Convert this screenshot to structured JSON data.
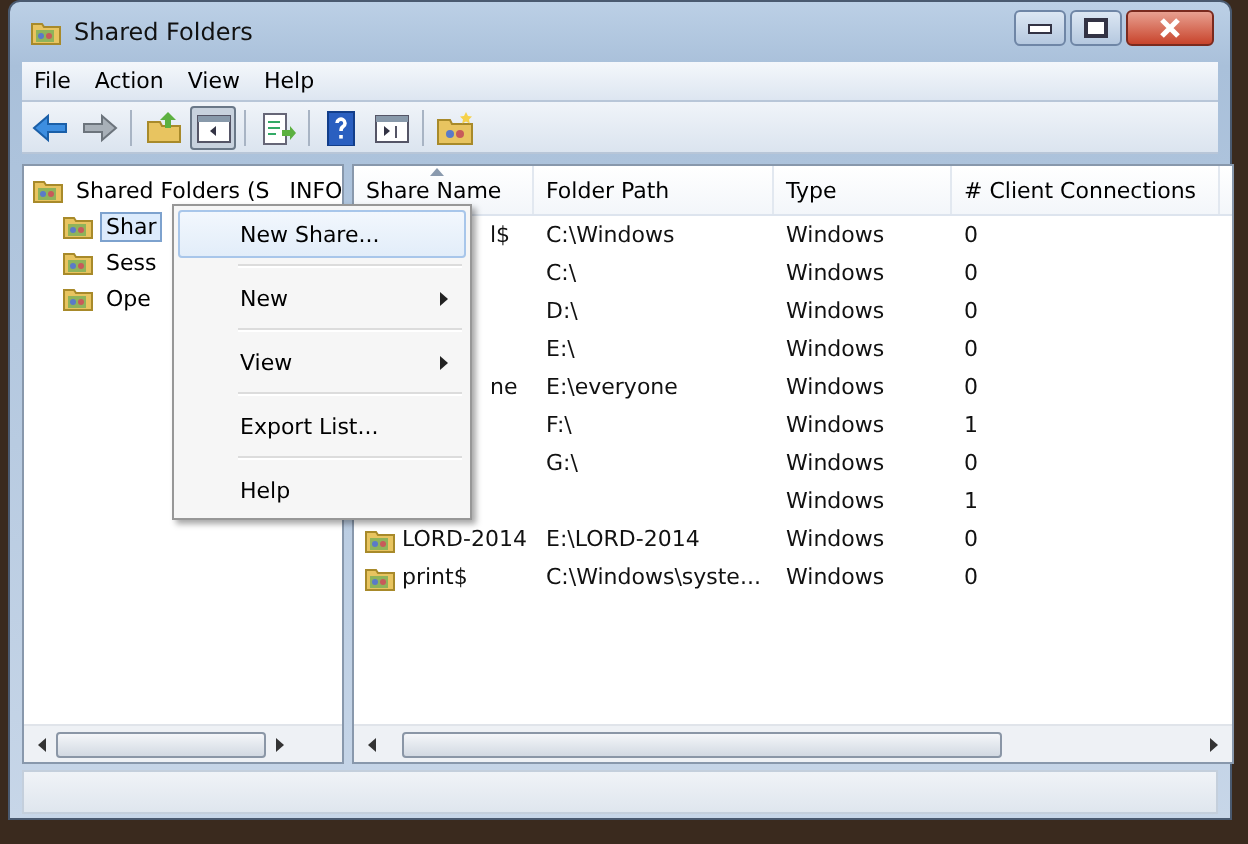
{
  "window": {
    "title": "Shared Folders"
  },
  "menu_bar": [
    {
      "label": "File"
    },
    {
      "label": "Action"
    },
    {
      "label": "View"
    },
    {
      "label": "Help"
    }
  ],
  "toolbar": [
    {
      "kind": "back",
      "pressed": false
    },
    {
      "kind": "forward",
      "pressed": false
    },
    {
      "kind": "sep"
    },
    {
      "kind": "up",
      "pressed": false
    },
    {
      "kind": "tree",
      "pressed": true
    },
    {
      "kind": "sep"
    },
    {
      "kind": "export",
      "pressed": false
    },
    {
      "kind": "sep"
    },
    {
      "kind": "help",
      "pressed": false
    },
    {
      "kind": "pane",
      "pressed": false
    },
    {
      "kind": "sep"
    },
    {
      "kind": "share",
      "pressed": false
    }
  ],
  "tree": [
    {
      "label": "Shared Folders (S",
      "label_tail": "INFO",
      "selected": false,
      "children": [
        {
          "label": "Shar",
          "selected": true
        },
        {
          "label": "Sess",
          "selected": false
        },
        {
          "label": "Ope",
          "selected": false
        }
      ]
    }
  ],
  "table": {
    "columns": [
      {
        "label": "Share Name",
        "sorted": true
      },
      {
        "label": "Folder Path",
        "sorted": false
      },
      {
        "label": "Type",
        "sorted": false
      },
      {
        "label": "# Client Connections",
        "sorted": false
      }
    ],
    "rows": [
      {
        "kind": "under_menu",
        "name": "l$",
        "path": "C:\\Windows",
        "type": "Windows",
        "clients": "0"
      },
      {
        "kind": "under_menu",
        "path": "C:\\",
        "type": "Windows",
        "clients": "0"
      },
      {
        "kind": "under_menu",
        "path": "D:\\",
        "type": "Windows",
        "clients": "0"
      },
      {
        "kind": "under_menu",
        "path": "E:\\",
        "type": "Windows",
        "clients": "0"
      },
      {
        "kind": "under_menu",
        "name": "ne",
        "path": "E:\\everyone",
        "type": "Windows",
        "clients": "0"
      },
      {
        "kind": "under_menu",
        "path": "F:\\",
        "type": "Windows",
        "clients": "1"
      },
      {
        "kind": "under_menu",
        "path": "G:\\",
        "type": "Windows",
        "clients": "0"
      },
      {
        "kind": "under_menu",
        "type": "Windows",
        "clients": "1"
      },
      {
        "kind": "share",
        "name": "LORD-2014",
        "path": "E:\\LORD-2014",
        "type": "Windows",
        "clients": "0"
      },
      {
        "kind": "share",
        "name": "print$",
        "path": "C:\\Windows\\syste...",
        "type": "Windows",
        "clients": "0"
      }
    ]
  },
  "context_menu": {
    "items": [
      {
        "kind": "item",
        "label": "New Share...",
        "highlighted": true,
        "submenu": false
      },
      {
        "kind": "separator"
      },
      {
        "kind": "item",
        "label": "New",
        "highlighted": false,
        "submenu": true
      },
      {
        "kind": "separator"
      },
      {
        "kind": "item",
        "label": "View",
        "highlighted": false,
        "submenu": true
      },
      {
        "kind": "separator"
      },
      {
        "kind": "item",
        "label": "Export List...",
        "highlighted": false,
        "submenu": false
      },
      {
        "kind": "separator"
      },
      {
        "kind": "item",
        "label": "Help",
        "highlighted": false,
        "submenu": false
      }
    ]
  }
}
